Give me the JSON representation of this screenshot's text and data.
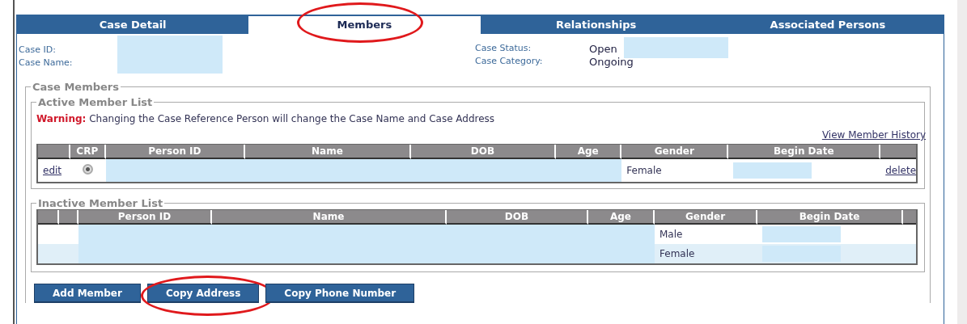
{
  "tabs": [
    {
      "label": "Case Detail",
      "selected": false,
      "circled": false
    },
    {
      "label": "Members",
      "selected": true,
      "circled": true
    },
    {
      "label": "Relationships",
      "selected": false,
      "circled": false
    },
    {
      "label": "Associated Persons",
      "selected": false,
      "circled": false
    }
  ],
  "case_info": {
    "left": [
      {
        "label": "Case ID:"
      },
      {
        "label": "Case Name:"
      }
    ],
    "left_redacted": true,
    "right": [
      {
        "label": "Case Status:",
        "value": "Open",
        "redacted_after": true
      },
      {
        "label": "Case Category:",
        "value": "Ongoing",
        "redacted_after": false
      }
    ]
  },
  "case_members": {
    "legend": "Case Members",
    "active": {
      "legend": "Active Member List",
      "warning_label": "Warning:",
      "warning_text": "Changing the Case Reference Person will change the Case Name and Case Address",
      "history_link": "View Member History",
      "columns": [
        "",
        "CRP",
        "Person ID",
        "Name",
        "DOB",
        "Age",
        "Gender",
        "Begin Date",
        ""
      ],
      "rows": [
        {
          "shaded": false,
          "cells": [
            {
              "kind": "link",
              "text": "edit"
            },
            {
              "kind": "radio",
              "checked": true
            },
            {
              "kind": "redacted"
            },
            {
              "kind": "redacted"
            },
            {
              "kind": "redacted"
            },
            {
              "kind": "redacted"
            },
            {
              "kind": "text",
              "text": "Female"
            },
            {
              "kind": "redacted_short"
            },
            {
              "kind": "link",
              "text": "delete"
            }
          ]
        }
      ]
    },
    "inactive": {
      "legend": "Inactive Member List",
      "columns": [
        "",
        "",
        "Person ID",
        "Name",
        "DOB",
        "Age",
        "Gender",
        "Begin Date",
        ""
      ],
      "rows": [
        {
          "shaded": false,
          "cells": [
            {
              "kind": "empty"
            },
            {
              "kind": "empty"
            },
            {
              "kind": "redacted"
            },
            {
              "kind": "redacted"
            },
            {
              "kind": "redacted"
            },
            {
              "kind": "redacted"
            },
            {
              "kind": "text",
              "text": "Male"
            },
            {
              "kind": "redacted_short"
            },
            {
              "kind": "empty"
            }
          ]
        },
        {
          "shaded": true,
          "cells": [
            {
              "kind": "empty"
            },
            {
              "kind": "empty"
            },
            {
              "kind": "redacted"
            },
            {
              "kind": "redacted"
            },
            {
              "kind": "redacted"
            },
            {
              "kind": "redacted"
            },
            {
              "kind": "text",
              "text": "Female"
            },
            {
              "kind": "redacted_short"
            },
            {
              "kind": "empty"
            }
          ]
        }
      ]
    }
  },
  "buttons": [
    {
      "label": "Add Member",
      "circled": false
    },
    {
      "label": "Copy Address",
      "circled": true
    },
    {
      "label": "Copy Phone Number",
      "circled": false
    }
  ]
}
